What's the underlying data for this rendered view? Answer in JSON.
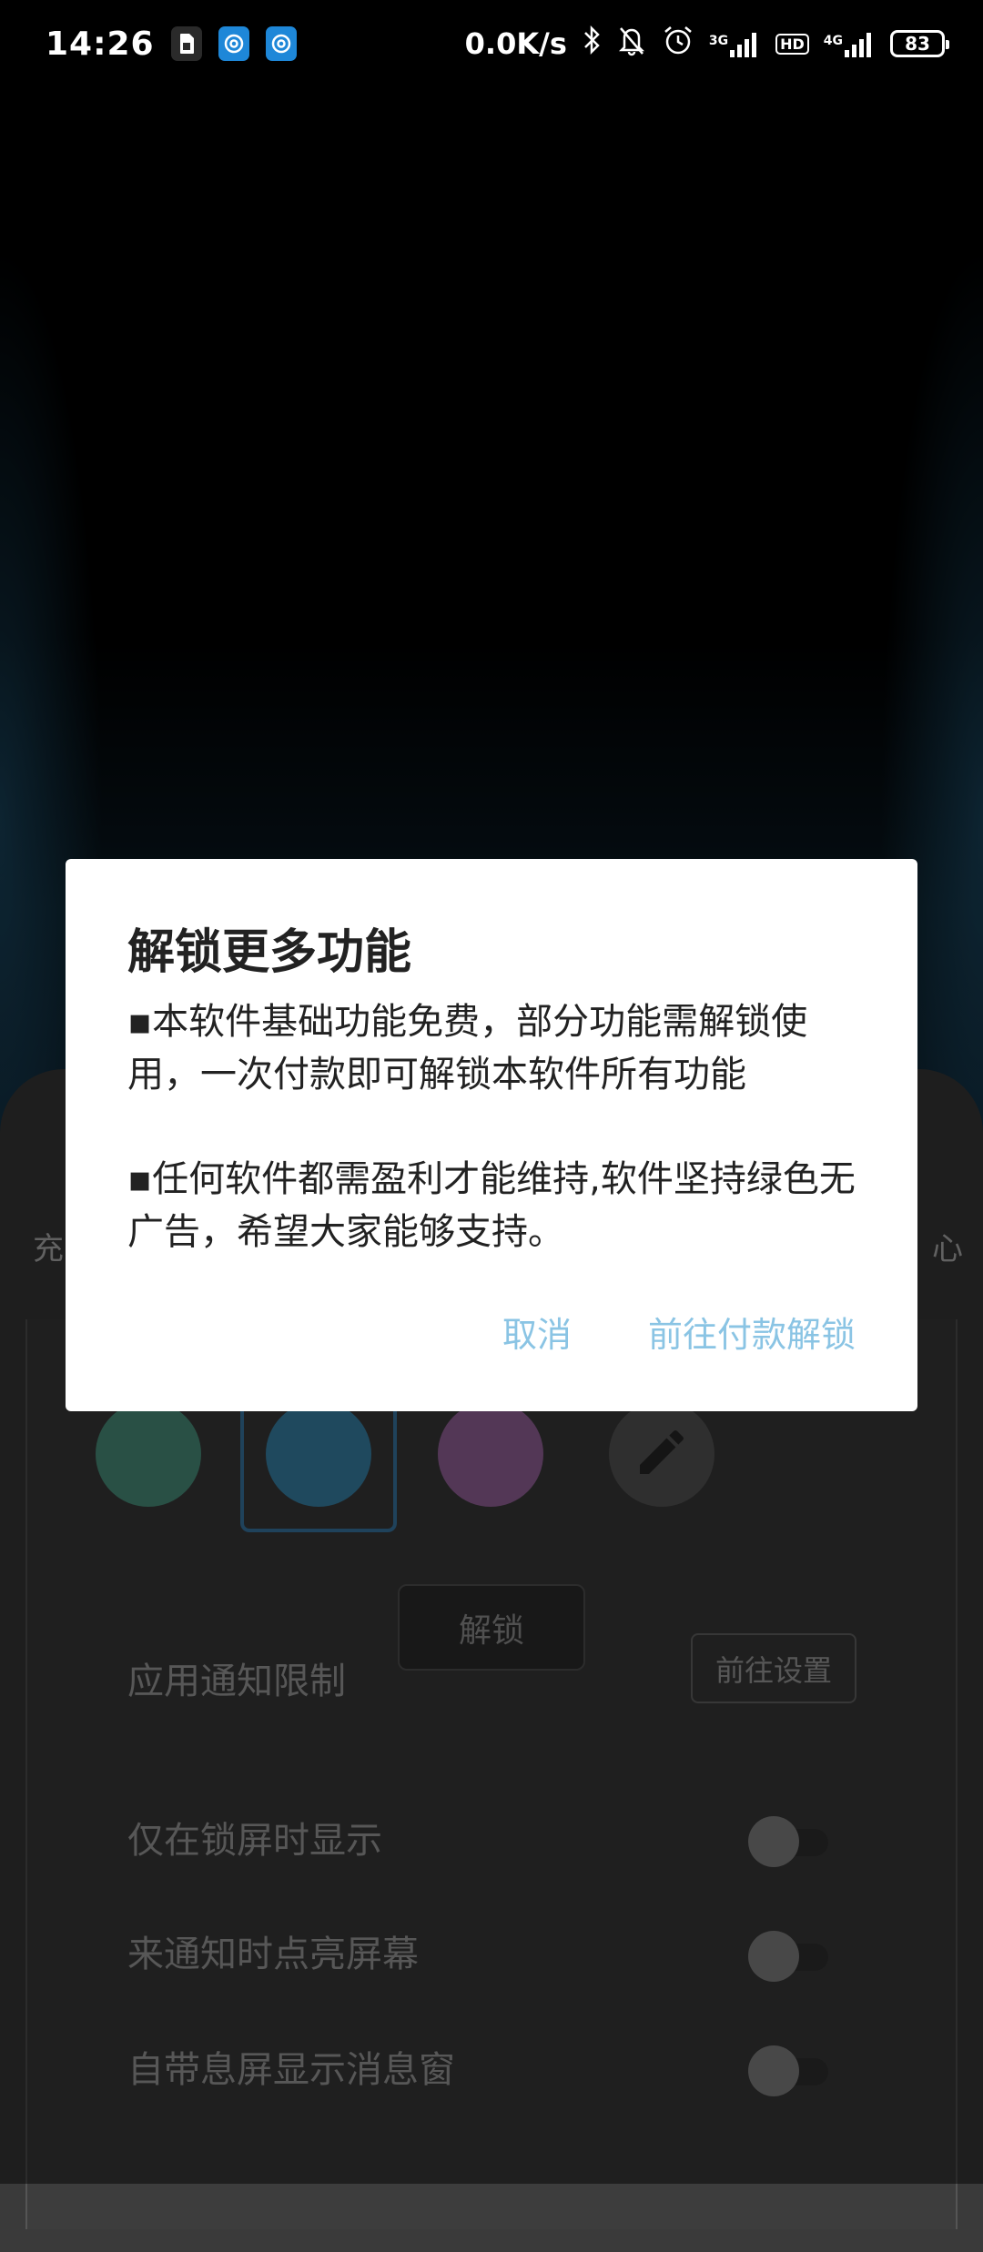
{
  "status_bar": {
    "time": "14:26",
    "net_speed": "0.0K/s",
    "sim1_label": "3G",
    "hd_label": "HD",
    "sim2_label": "4G",
    "battery": "83"
  },
  "background": {
    "tab_left": "充",
    "tab_right": "心",
    "unlock_button": "解锁",
    "app_notify_limit": "应用通知限制",
    "go_settings": "前往设置",
    "only_lockscreen": "仅在锁屏时显示",
    "wake_screen": "来通知时点亮屏幕",
    "builtin_popup": "自带息屏显示消息窗",
    "swatch_colors": [
      "#4f9a85",
      "#3d8cb5",
      "#a06aa6"
    ]
  },
  "dialog": {
    "title": "解锁更多功能",
    "paragraph1": "▪本软件基础功能免费，部分功能需解锁使用，一次付款即可解锁本软件所有功能",
    "paragraph2": "▪任何软件都需盈利才能维持,软件坚持绿色无广告，希望大家能够支持。",
    "cancel": "取消",
    "pay_unlock": "前往付款解锁"
  }
}
